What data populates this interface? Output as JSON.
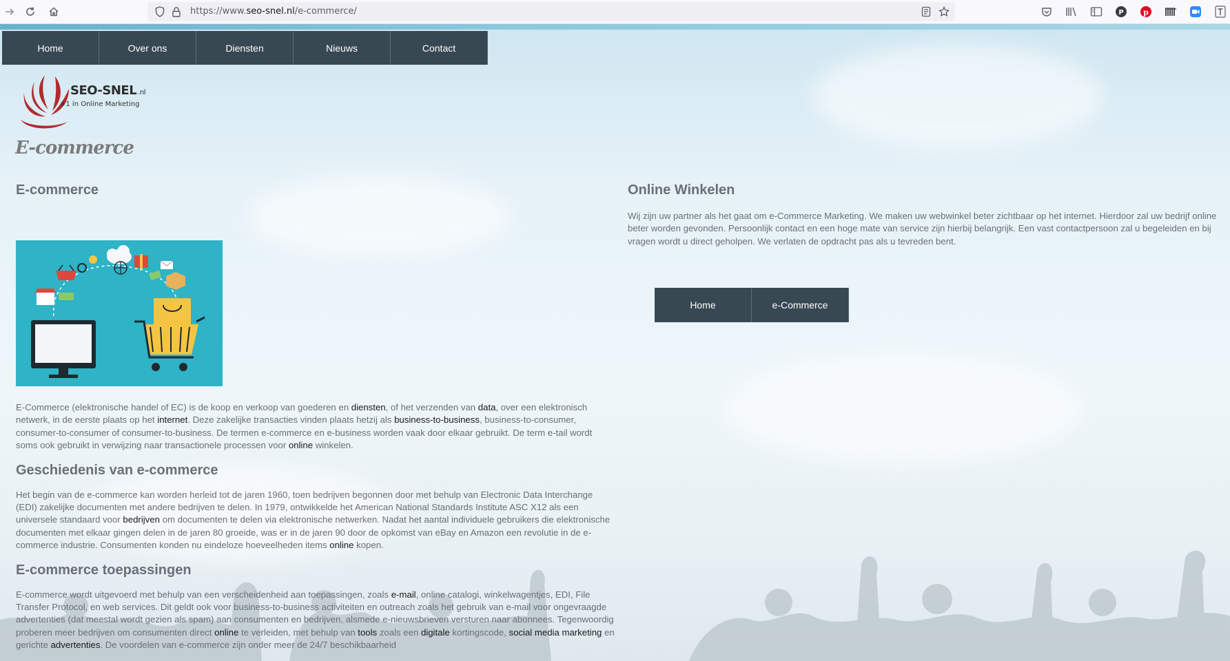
{
  "browser": {
    "url_prefix": "https://www.",
    "url_domain": "seo-snel.nl",
    "url_path": "/e-commerce/"
  },
  "nav": {
    "items": [
      {
        "label": "Home"
      },
      {
        "label": "Over ons"
      },
      {
        "label": "Diensten"
      },
      {
        "label": "Nieuws"
      },
      {
        "label": "Contact"
      }
    ]
  },
  "logo": {
    "name": "SEO-SNEL",
    "suffix": ".nl",
    "tagline": "#1 in Online Marketing"
  },
  "page_title": "E-commerce",
  "sections": {
    "ecommerce": {
      "heading": "E-commerce",
      "p1": "E-Commerce (elektronische handel of EC) is de koop en verkoop van goederen en ",
      "l1": "diensten",
      "p2": ", of het verzenden van ",
      "l2": "data",
      "p3": ", over een elektronisch netwerk, in de eerste plaats op het ",
      "l3": "internet",
      "p4": ". Deze zakelijke transacties vinden plaats hetzij als ",
      "l4": "business-to-business",
      "p5": ", business-to-consumer, consumer-to-consumer of consumer-to-business. De termen e-commerce en e-business worden vaak door elkaar gebruikt. De term e-tail wordt soms ook gebruikt in verwijzing naar transactionele processen voor ",
      "l5": "online",
      "p6": " winkelen."
    },
    "geschiedenis": {
      "heading": "Geschiedenis van e-commerce",
      "p1": "Het begin van de e-commerce kan worden herleid tot de jaren 1960, toen bedrijven begonnen door met behulp van Electronic Data Interchange (EDI) zakelijke documenten met andere bedrijven te delen. In 1979, ontwikkelde het American National Standards Institute ASC X12 als een universele standaard voor ",
      "l1": "bedrijven",
      "p2": " om documenten te delen via elektronische netwerken. Nadat het aantal individuele gebruikers die elektronische documenten met elkaar gingen delen in de jaren 80 groeide, was er in de jaren 90 door de opkomst van eBay en Amazon een revolutie in de e-commerce industrie. Consumenten konden nu eindeloze hoeveelheden items ",
      "l2": "online",
      "p3": " kopen."
    },
    "toepassingen": {
      "heading": "E-commerce toepassingen",
      "p1": "E-commerce wordt uitgevoerd met behulp van een verscheidenheid aan toepassingen, zoals ",
      "l1": "e-mail",
      "p2": ", online catalogi, winkelwagentjes, EDI, File Transfer Protocol, en web services. Dit geldt ook voor business-to-business activiteiten en outreach zoals het gebruik van e-mail voor ongevraagde advertenties (dat meestal wordt gezien als spam) aan consumenten en bedrijven, alsmede e-nieuwsbrieven versturen naar abonnees. Tegenwoordig proberen meer bedrijven om consumenten direct ",
      "l2": "online",
      "p3": " te verleiden, met behulp van ",
      "l3": "tools",
      "p4": " zoals een ",
      "l4": "digitale",
      "p5": " kortingscode, ",
      "l5": "social media marketing",
      "p6": " en gerichte ",
      "l6": "advertenties",
      "p7": ". De voordelen van e-commerce zijn onder meer de 24/7 beschikbaarheid"
    },
    "online_winkelen": {
      "heading": "Online Winkelen",
      "text": "Wij zijn uw partner als het gaat om e-Commerce Marketing. We maken uw webwinkel beter zichtbaar op het internet. Hierdoor zal uw bedrijf online beter worden gevonden. Persoonlijk contact en een hoge mate van service zijn hierbij belangrijk. Een vast contactpersoon zal u begeleiden en bij vragen wordt u direct geholpen. We verlaten de opdracht pas als u tevreden bent."
    }
  },
  "sub_nav": {
    "items": [
      {
        "label": "Home"
      },
      {
        "label": "e-Commerce"
      }
    ]
  },
  "colors": {
    "nav_bg": "#384853",
    "hero_bg": "#2eb3c7",
    "logo_red": "#b22a2e"
  }
}
